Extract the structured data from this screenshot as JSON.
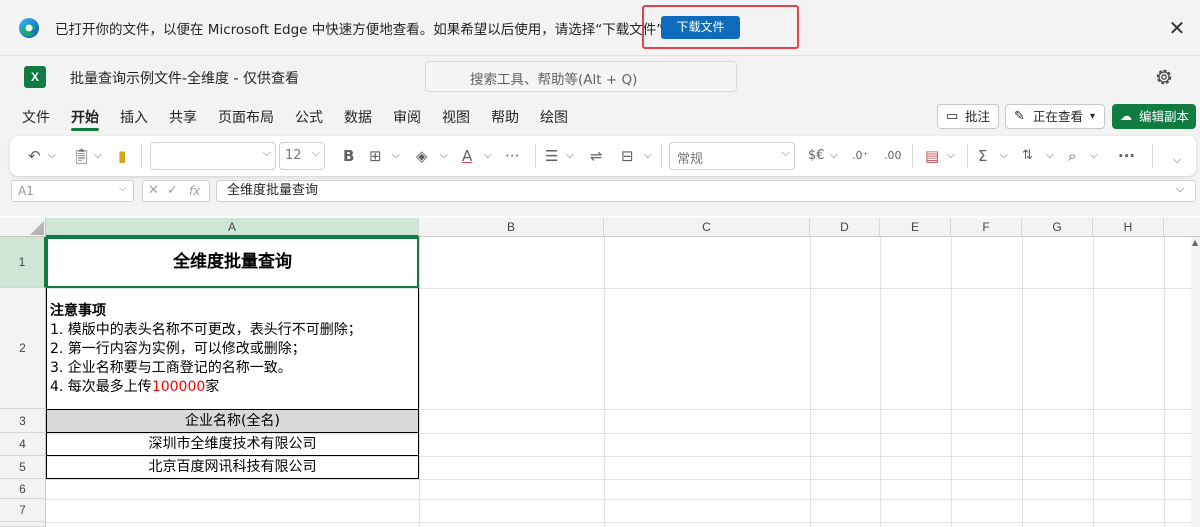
{
  "banner": {
    "message": "已打开你的文件，以便在 Microsoft Edge 中快速方便地查看。如果希望以后使用，请选择“下载文件”。",
    "download_button": "下载文件",
    "close_glyph": "✕"
  },
  "titlebar": {
    "app_logo": "X",
    "document_title": "批量查询示例文件-全维度  -  仅供查看",
    "search_placeholder": "搜索工具、帮助等(Alt + Q)"
  },
  "tabs": [
    "文件",
    "开始",
    "插入",
    "共享",
    "页面布局",
    "公式",
    "数据",
    "审阅",
    "视图",
    "帮助",
    "绘图"
  ],
  "active_tab": "开始",
  "ribbon_right": {
    "comments": "批注",
    "viewing": "正在查看",
    "edit_copy": "编辑副本"
  },
  "toolbar": {
    "font_size": "12",
    "number_format": "常规",
    "currency_symbol": "$€",
    "bold": "B",
    "more": "···"
  },
  "formula_bar": {
    "name_box": "A1",
    "fx": "fx",
    "formula": "全维度批量查询"
  },
  "columns": [
    "A",
    "B",
    "C",
    "D",
    "E",
    "F",
    "G",
    "H"
  ],
  "rows": [
    "1",
    "2",
    "3",
    "4",
    "5",
    "6",
    "7"
  ],
  "sheet": {
    "a1": "全维度批量查询",
    "notes_title": "注意事项",
    "note1": "1. 模版中的表头名称不可更改，表头行不可删除；",
    "note2": "2. 第一行内容为实例，可以修改或删除；",
    "note3": "3. 企业名称要与工商登记的名称一致。",
    "note4_prefix": "4. 每次最多上传",
    "note4_number": "100000",
    "note4_suffix": "家",
    "a3": "企业名称(全名)",
    "a4": "深圳市全维度技术有限公司",
    "a5": "北京百度网讯科技有限公司"
  },
  "colors": {
    "brand_green": "#107c41",
    "edge_blue": "#0f6cbd",
    "highlight_red": "#e0444f",
    "note_red": "#ff0000"
  }
}
